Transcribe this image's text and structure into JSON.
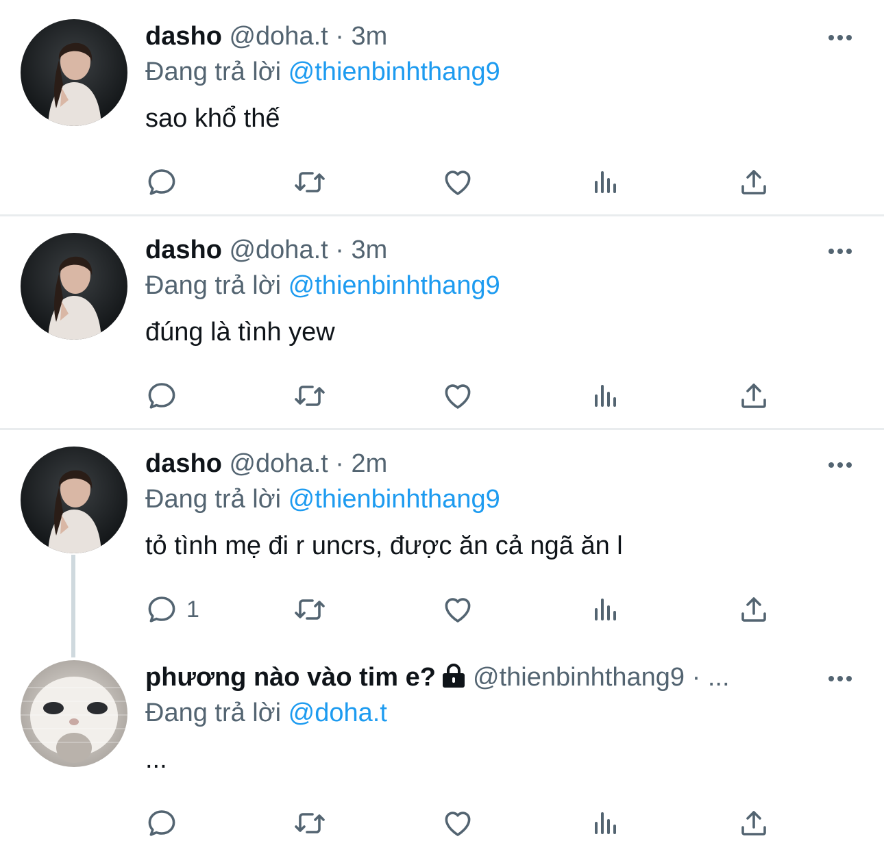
{
  "tweets": [
    {
      "name": "dasho",
      "handle": "@doha.t",
      "dot": "·",
      "time": "3m",
      "reply_prefix": "Đang trả lời",
      "reply_to": "@thienbinhthang9",
      "text": "sao khổ thế",
      "reply_count": ""
    },
    {
      "name": "dasho",
      "handle": "@doha.t",
      "dot": "·",
      "time": "3m",
      "reply_prefix": "Đang trả lời",
      "reply_to": "@thienbinhthang9",
      "text": "đúng là tình yew",
      "reply_count": ""
    },
    {
      "name": "dasho",
      "handle": "@doha.t",
      "dot": "·",
      "time": "2m",
      "reply_prefix": "Đang trả lời",
      "reply_to": "@thienbinhthang9",
      "text": "tỏ tình mẹ đi r uncrs, được ăn cả ngã ăn l",
      "reply_count": "1"
    },
    {
      "name": "phương nào vào tim e?",
      "handle": "@thienbinhthang9",
      "dot": "·",
      "time": "...",
      "reply_prefix": "Đang trả lời",
      "reply_to": "@doha.t",
      "text": "...",
      "reply_count": ""
    }
  ],
  "icons": {
    "more": "more-horizontal-icon",
    "reply": "reply-icon",
    "retweet": "retweet-icon",
    "like": "heart-icon",
    "views": "analytics-icon",
    "share": "share-icon",
    "lock": "lock-icon"
  },
  "colors": {
    "accent": "#1d9bf0",
    "muted": "#536471",
    "text": "#0f1419",
    "divider": "#e9ecee",
    "thread_line": "#cfd9de"
  }
}
